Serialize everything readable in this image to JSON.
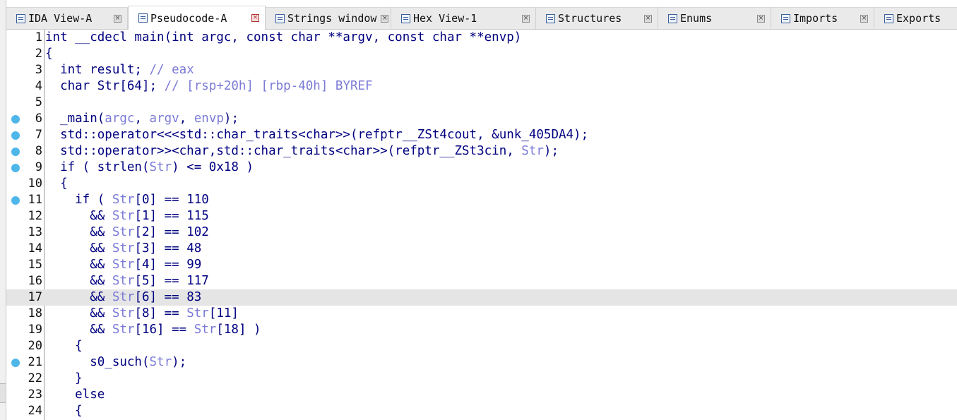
{
  "tabs": [
    {
      "label": "IDA View-A",
      "icon": "ida-view-icon",
      "active": false
    },
    {
      "label": "Pseudocode-A",
      "icon": "pseudocode-icon",
      "active": true
    },
    {
      "label": "Strings window",
      "icon": "strings-icon",
      "active": false
    },
    {
      "label": "Hex View-1",
      "icon": "hex-view-icon",
      "active": false
    },
    {
      "label": "Structures",
      "icon": "structures-icon",
      "active": false
    },
    {
      "label": "Enums",
      "icon": "enums-icon",
      "active": false
    },
    {
      "label": "Imports",
      "icon": "imports-icon",
      "active": false
    },
    {
      "label": "Exports",
      "icon": "exports-icon",
      "active": false
    }
  ],
  "tab_close_glyph": "×",
  "editor": {
    "highlighted_line": 17,
    "lines": [
      {
        "num": "1",
        "bp": false,
        "segs": [
          [
            "int __cdecl main(int argc, const char **argv, const char **envp)",
            ""
          ]
        ]
      },
      {
        "num": "2",
        "bp": false,
        "segs": [
          [
            "{",
            ""
          ]
        ]
      },
      {
        "num": "3",
        "bp": false,
        "segs": [
          [
            "  int result; ",
            ""
          ],
          [
            "// eax",
            "c"
          ]
        ]
      },
      {
        "num": "4",
        "bp": false,
        "segs": [
          [
            "  char Str[64]; ",
            ""
          ],
          [
            "// [rsp+20h] [rbp-40h] BYREF",
            "c"
          ]
        ]
      },
      {
        "num": "5",
        "bp": false,
        "segs": [
          [
            "",
            ""
          ]
        ]
      },
      {
        "num": "6",
        "bp": true,
        "segs": [
          [
            "  _main(",
            ""
          ],
          [
            "argc",
            "v"
          ],
          [
            ", ",
            ""
          ],
          [
            "argv",
            "v"
          ],
          [
            ", ",
            ""
          ],
          [
            "envp",
            "v"
          ],
          [
            ");",
            ""
          ]
        ]
      },
      {
        "num": "7",
        "bp": true,
        "segs": [
          [
            "  std::operator<<<std::char_traits<char>>(refptr__ZSt4cout, &unk_405DA4);",
            ""
          ]
        ]
      },
      {
        "num": "8",
        "bp": true,
        "segs": [
          [
            "  std::operator>><char,std::char_traits<char>>(refptr__ZSt3cin, ",
            ""
          ],
          [
            "Str",
            "v"
          ],
          [
            ");",
            ""
          ]
        ]
      },
      {
        "num": "9",
        "bp": true,
        "segs": [
          [
            "  if ( strlen(",
            ""
          ],
          [
            "Str",
            "v"
          ],
          [
            ") <= 0x18 )",
            ""
          ]
        ]
      },
      {
        "num": "10",
        "bp": false,
        "segs": [
          [
            "  {",
            ""
          ]
        ]
      },
      {
        "num": "11",
        "bp": true,
        "segs": [
          [
            "    if ( ",
            ""
          ],
          [
            "Str",
            "v"
          ],
          [
            "[0] == 110",
            ""
          ]
        ]
      },
      {
        "num": "12",
        "bp": false,
        "segs": [
          [
            "      && ",
            ""
          ],
          [
            "Str",
            "v"
          ],
          [
            "[1] == 115",
            ""
          ]
        ]
      },
      {
        "num": "13",
        "bp": false,
        "segs": [
          [
            "      && ",
            ""
          ],
          [
            "Str",
            "v"
          ],
          [
            "[2] == 102",
            ""
          ]
        ]
      },
      {
        "num": "14",
        "bp": false,
        "segs": [
          [
            "      && ",
            ""
          ],
          [
            "Str",
            "v"
          ],
          [
            "[3] == 48",
            ""
          ]
        ]
      },
      {
        "num": "15",
        "bp": false,
        "segs": [
          [
            "      && ",
            ""
          ],
          [
            "Str",
            "v"
          ],
          [
            "[4] == 99",
            ""
          ]
        ]
      },
      {
        "num": "16",
        "bp": false,
        "segs": [
          [
            "      && ",
            ""
          ],
          [
            "Str",
            "v"
          ],
          [
            "[5] == 117",
            ""
          ]
        ]
      },
      {
        "num": "17",
        "bp": false,
        "segs": [
          [
            "      && ",
            ""
          ],
          [
            "Str",
            "v"
          ],
          [
            "[6] == 83",
            ""
          ]
        ]
      },
      {
        "num": "18",
        "bp": false,
        "segs": [
          [
            "      && ",
            ""
          ],
          [
            "Str",
            "v"
          ],
          [
            "[8] == ",
            ""
          ],
          [
            "Str",
            "v"
          ],
          [
            "[11]",
            ""
          ]
        ]
      },
      {
        "num": "19",
        "bp": false,
        "segs": [
          [
            "      && ",
            ""
          ],
          [
            "Str",
            "v"
          ],
          [
            "[16] == ",
            ""
          ],
          [
            "Str",
            "v"
          ],
          [
            "[18] )",
            ""
          ]
        ]
      },
      {
        "num": "20",
        "bp": false,
        "segs": [
          [
            "    {",
            ""
          ]
        ]
      },
      {
        "num": "21",
        "bp": true,
        "segs": [
          [
            "      s0_such(",
            ""
          ],
          [
            "Str",
            "v"
          ],
          [
            ");",
            ""
          ]
        ]
      },
      {
        "num": "22",
        "bp": false,
        "segs": [
          [
            "    }",
            ""
          ]
        ]
      },
      {
        "num": "23",
        "bp": false,
        "segs": [
          [
            "    else",
            ""
          ]
        ]
      },
      {
        "num": "24",
        "bp": false,
        "segs": [
          [
            "    {",
            ""
          ]
        ]
      }
    ]
  }
}
